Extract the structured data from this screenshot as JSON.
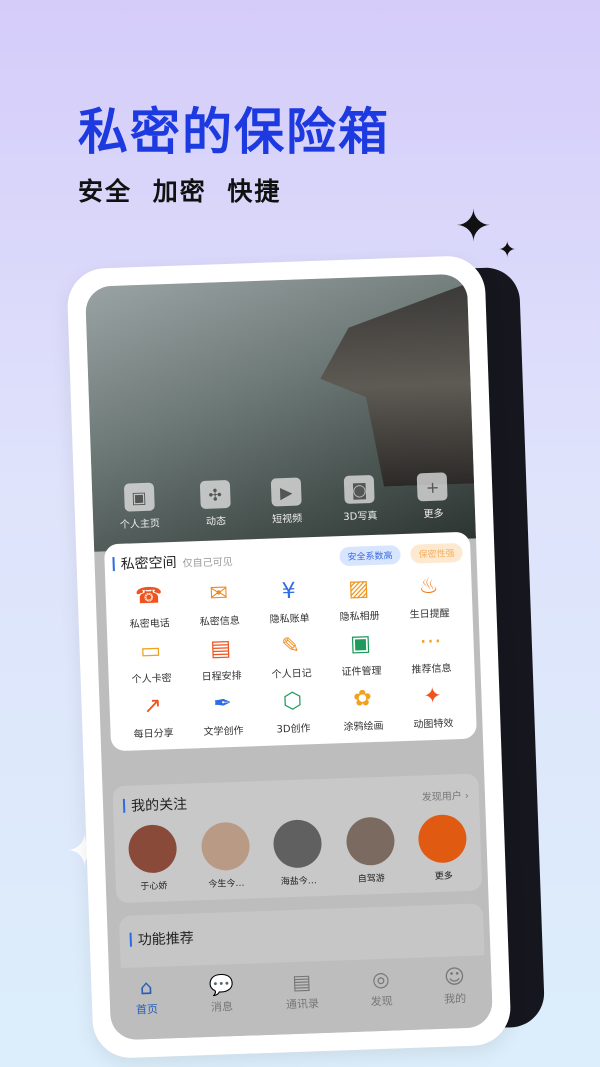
{
  "headline": "私密的保险箱",
  "subtitle": "安全 加密 快捷",
  "quick": [
    {
      "label": "个人主页",
      "icon": "id-card-icon",
      "g": "▣"
    },
    {
      "label": "动态",
      "icon": "pinwheel-icon",
      "g": "✣"
    },
    {
      "label": "短视频",
      "icon": "video-icon",
      "g": "▶"
    },
    {
      "label": "3D写真",
      "icon": "camera-3d-icon",
      "g": "◙"
    },
    {
      "label": "更多",
      "icon": "plus-icon",
      "g": "+"
    }
  ],
  "private": {
    "title": "私密空间",
    "hint": "仅自己可见",
    "badge_safe": "安全系数高",
    "badge_secret": "保密性强",
    "items": [
      {
        "label": "私密电话",
        "icon": "phone-icon",
        "g": "☎",
        "color": "#f0541e"
      },
      {
        "label": "私密信息",
        "icon": "message-icon",
        "g": "✉",
        "color": "#f08a1e"
      },
      {
        "label": "隐私账单",
        "icon": "bill-icon",
        "g": "¥",
        "color": "#2e6be6"
      },
      {
        "label": "隐私相册",
        "icon": "album-icon",
        "g": "▨",
        "color": "#f0961e"
      },
      {
        "label": "生日提醒",
        "icon": "cake-icon",
        "g": "♨",
        "color": "#f07a1e"
      },
      {
        "label": "个人卡密",
        "icon": "card-icon",
        "g": "▭",
        "color": "#f0a21e"
      },
      {
        "label": "日程安排",
        "icon": "calendar-icon",
        "g": "▤",
        "color": "#f0541e"
      },
      {
        "label": "个人日记",
        "icon": "diary-icon",
        "g": "✎",
        "color": "#f08a1e"
      },
      {
        "label": "证件管理",
        "icon": "id-icon",
        "g": "▣",
        "color": "#1e9a5c"
      },
      {
        "label": "推荐信息",
        "icon": "chat-icon",
        "g": "⋯",
        "color": "#f0a21e"
      },
      {
        "label": "每日分享",
        "icon": "share-icon",
        "g": "↗",
        "color": "#f0541e"
      },
      {
        "label": "文学创作",
        "icon": "quill-icon",
        "g": "✒",
        "color": "#2e6be6"
      },
      {
        "label": "3D创作",
        "icon": "cube-icon",
        "g": "⬡",
        "color": "#1e9a5c"
      },
      {
        "label": "涂鸦绘画",
        "icon": "palette-icon",
        "g": "✿",
        "color": "#f0a21e"
      },
      {
        "label": "动图特效",
        "icon": "magic-wand-icon",
        "g": "✦",
        "color": "#f0541e"
      }
    ]
  },
  "follow": {
    "title": "我的关注",
    "discover": "发现用户 ›",
    "users": [
      {
        "name": "于心娇",
        "color": "#8a4a3a"
      },
      {
        "name": "今生今…",
        "color": "#b99a84"
      },
      {
        "name": "海盐今…",
        "color": "#606060"
      },
      {
        "name": "自驾游",
        "color": "#7a6a60"
      },
      {
        "name": "更多",
        "color": "#e05a12"
      }
    ]
  },
  "recommend": {
    "title": "功能推荐"
  },
  "tabs": [
    {
      "label": "首页",
      "icon": "home-icon",
      "g": "⌂"
    },
    {
      "label": "消息",
      "icon": "chat-bubble-icon",
      "g": "💬"
    },
    {
      "label": "通讯录",
      "icon": "contacts-icon",
      "g": "▤"
    },
    {
      "label": "发现",
      "icon": "compass-icon",
      "g": "◎"
    },
    {
      "label": "我的",
      "icon": "profile-icon",
      "g": "☺"
    }
  ]
}
